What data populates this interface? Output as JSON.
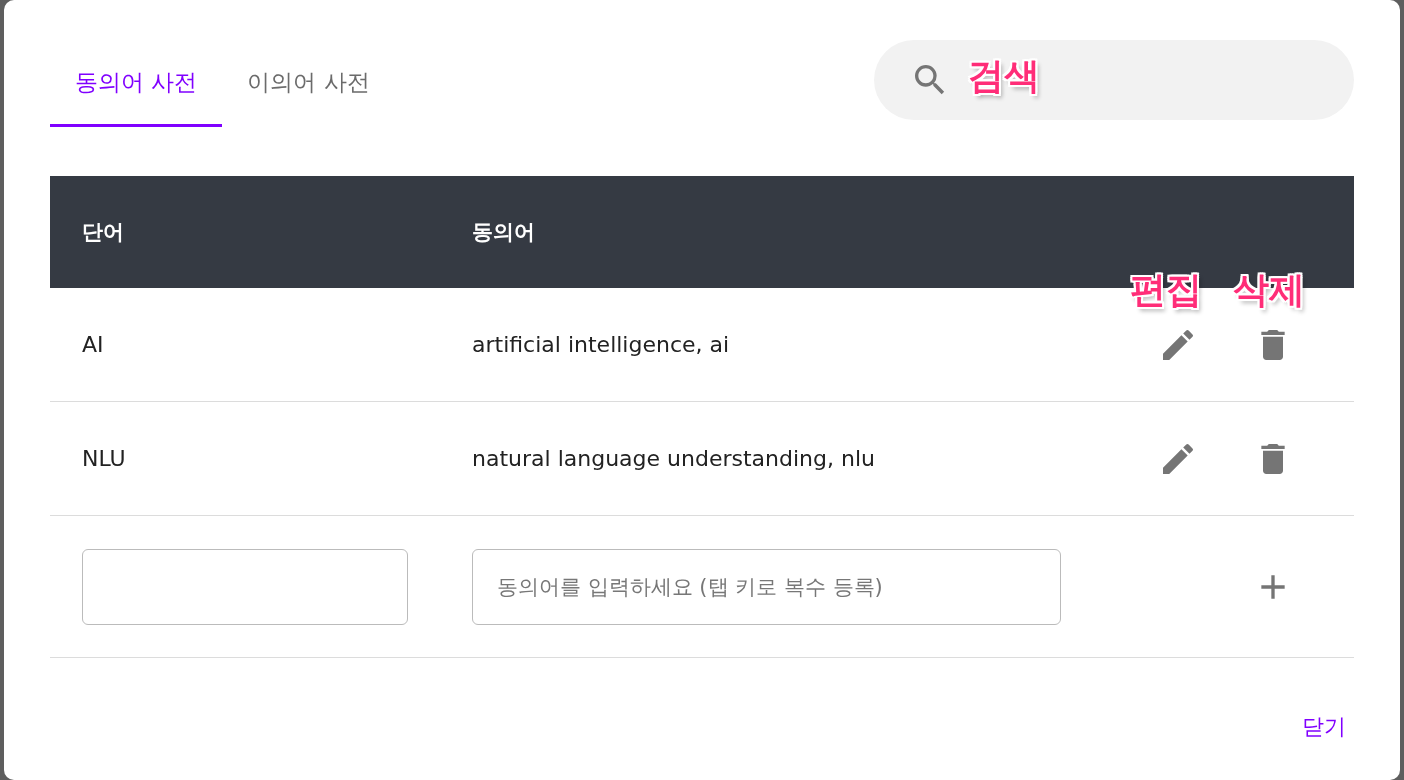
{
  "tabs": [
    {
      "label": "동의어 사전",
      "selected": true
    },
    {
      "label": "이의어 사전",
      "selected": false
    }
  ],
  "search": {
    "annotation": "검색"
  },
  "table": {
    "columns": [
      "단어",
      "동의어"
    ],
    "action_annotations": [
      "편집",
      "삭제"
    ],
    "rows": [
      {
        "word": "AI",
        "synonyms": "artificial intelligence, ai"
      },
      {
        "word": "NLU",
        "synonyms": "natural language understanding, nlu"
      }
    ],
    "new_row": {
      "synonym_placeholder": "동의어를 입력하세요 (탭 키로 복수 등록)"
    }
  },
  "close_button": "닫기"
}
